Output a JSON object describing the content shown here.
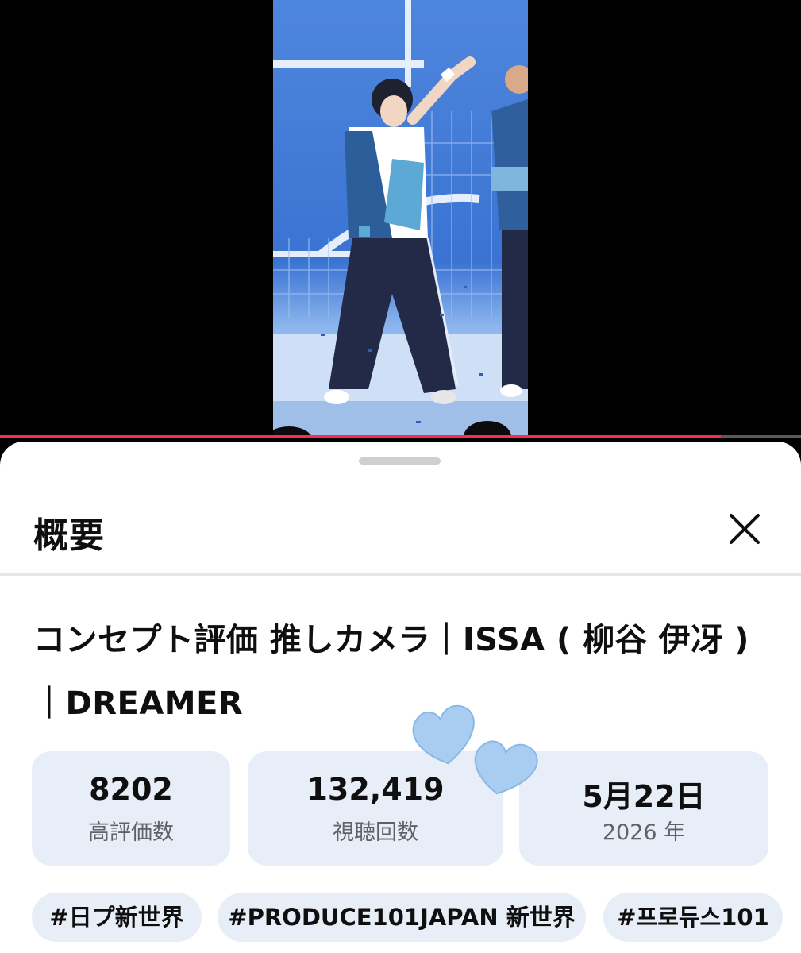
{
  "player": {
    "progress": 0.9
  },
  "overview": {
    "title": "概要",
    "close_icon": "close-icon",
    "video_title": "コンセプト評価 推しカメラ｜ISSA ( 柳谷 伊冴 )｜DREAMER"
  },
  "stats": [
    {
      "value": "8202",
      "label": "高評価数"
    },
    {
      "value": "132,419",
      "label": "視聴回数"
    },
    {
      "value": "5月22日",
      "label": "2026 年"
    }
  ],
  "tags": [
    "#日プ新世界",
    "#PRODUCE101JAPAN 新世界",
    "#프로듀스101"
  ],
  "colors": {
    "progress": "#ff2a4d",
    "card_bg": "#e8eef8",
    "heart": "#a9cdf0"
  }
}
